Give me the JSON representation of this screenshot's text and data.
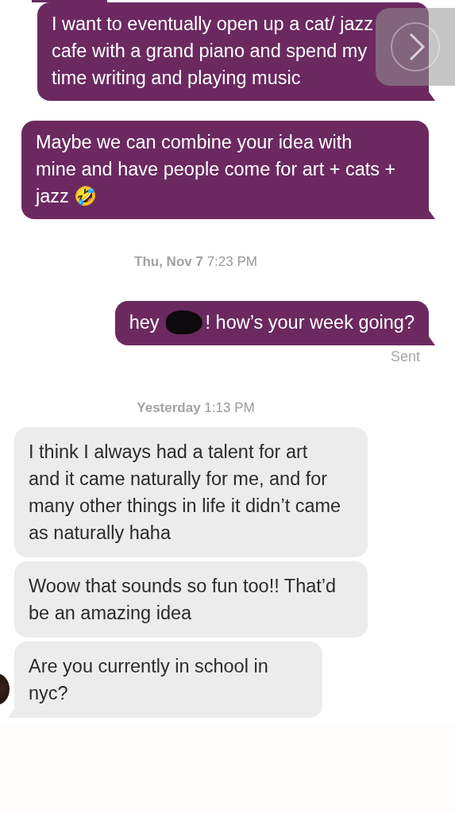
{
  "thread": [
    {
      "kind": "sent",
      "text": "I want to eventually open up a cat/ jazz cafe with a grand piano and spend my time writing and playing music",
      "tail": true
    },
    {
      "kind": "sent",
      "text": "Maybe we can combine your idea with mine and have people come for art + cats + jazz 🤣",
      "tail": true
    },
    {
      "kind": "timestamp",
      "day": "Thu, Nov 7",
      "time": "7:23 PM"
    },
    {
      "kind": "sent",
      "before": "hey",
      "redacted": true,
      "after": "! how’s your week going?",
      "tail": true,
      "status": "Sent"
    },
    {
      "kind": "timestamp",
      "day": "Yesterday",
      "time": "1:13 PM"
    },
    {
      "kind": "received",
      "text": "I think I always had a talent for art and it came naturally for me, and for many other things in life it didn’t came as naturally haha",
      "tail": false,
      "avatar": false
    },
    {
      "kind": "received",
      "text": "Woow that sounds so fun too!! That’d be an amazing idea",
      "tail": false,
      "avatar": false
    },
    {
      "kind": "received",
      "text": "Are you currently in school in nyc?",
      "tail": true,
      "avatar": true
    }
  ],
  "overlay_button": {
    "visible": true
  }
}
